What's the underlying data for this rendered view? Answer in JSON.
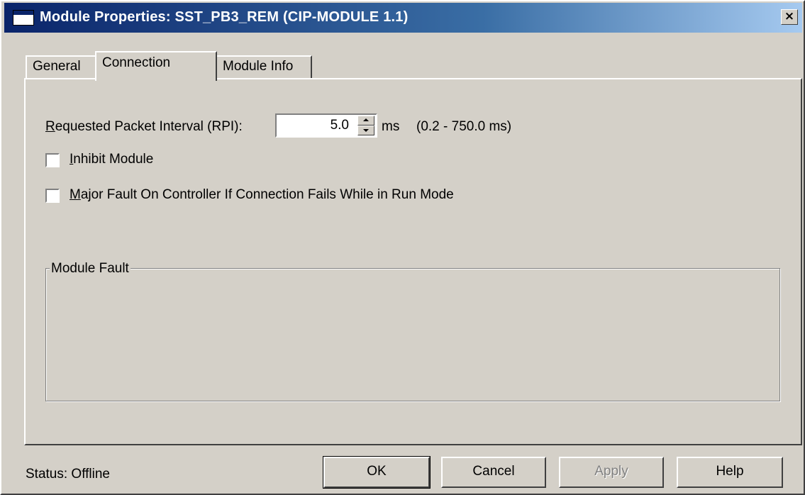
{
  "window": {
    "title": "Module Properties: SST_PB3_REM (CIP-MODULE 1.1)",
    "close_label": "×"
  },
  "tabs": [
    {
      "label": "General"
    },
    {
      "label": "Connection"
    },
    {
      "label": "Module Info"
    }
  ],
  "connection": {
    "rpi_label_first": "R",
    "rpi_label_rest": "equested Packet Interval (RPI):",
    "rpi_value": "5.0",
    "rpi_unit": "ms",
    "rpi_range": "(0.2 - 750.0 ms)",
    "inhibit_first": "I",
    "inhibit_rest": "nhibit Module",
    "inhibit_checked": false,
    "major_fault_first": "M",
    "major_fault_rest": "ajor Fault On Controller If Connection Fails While in Run Mode",
    "major_fault_checked": false,
    "module_fault_title": "Module Fault"
  },
  "footer": {
    "status": "Status:  Offline",
    "ok": "OK",
    "cancel": "Cancel",
    "apply": "Apply",
    "help": "Help"
  }
}
